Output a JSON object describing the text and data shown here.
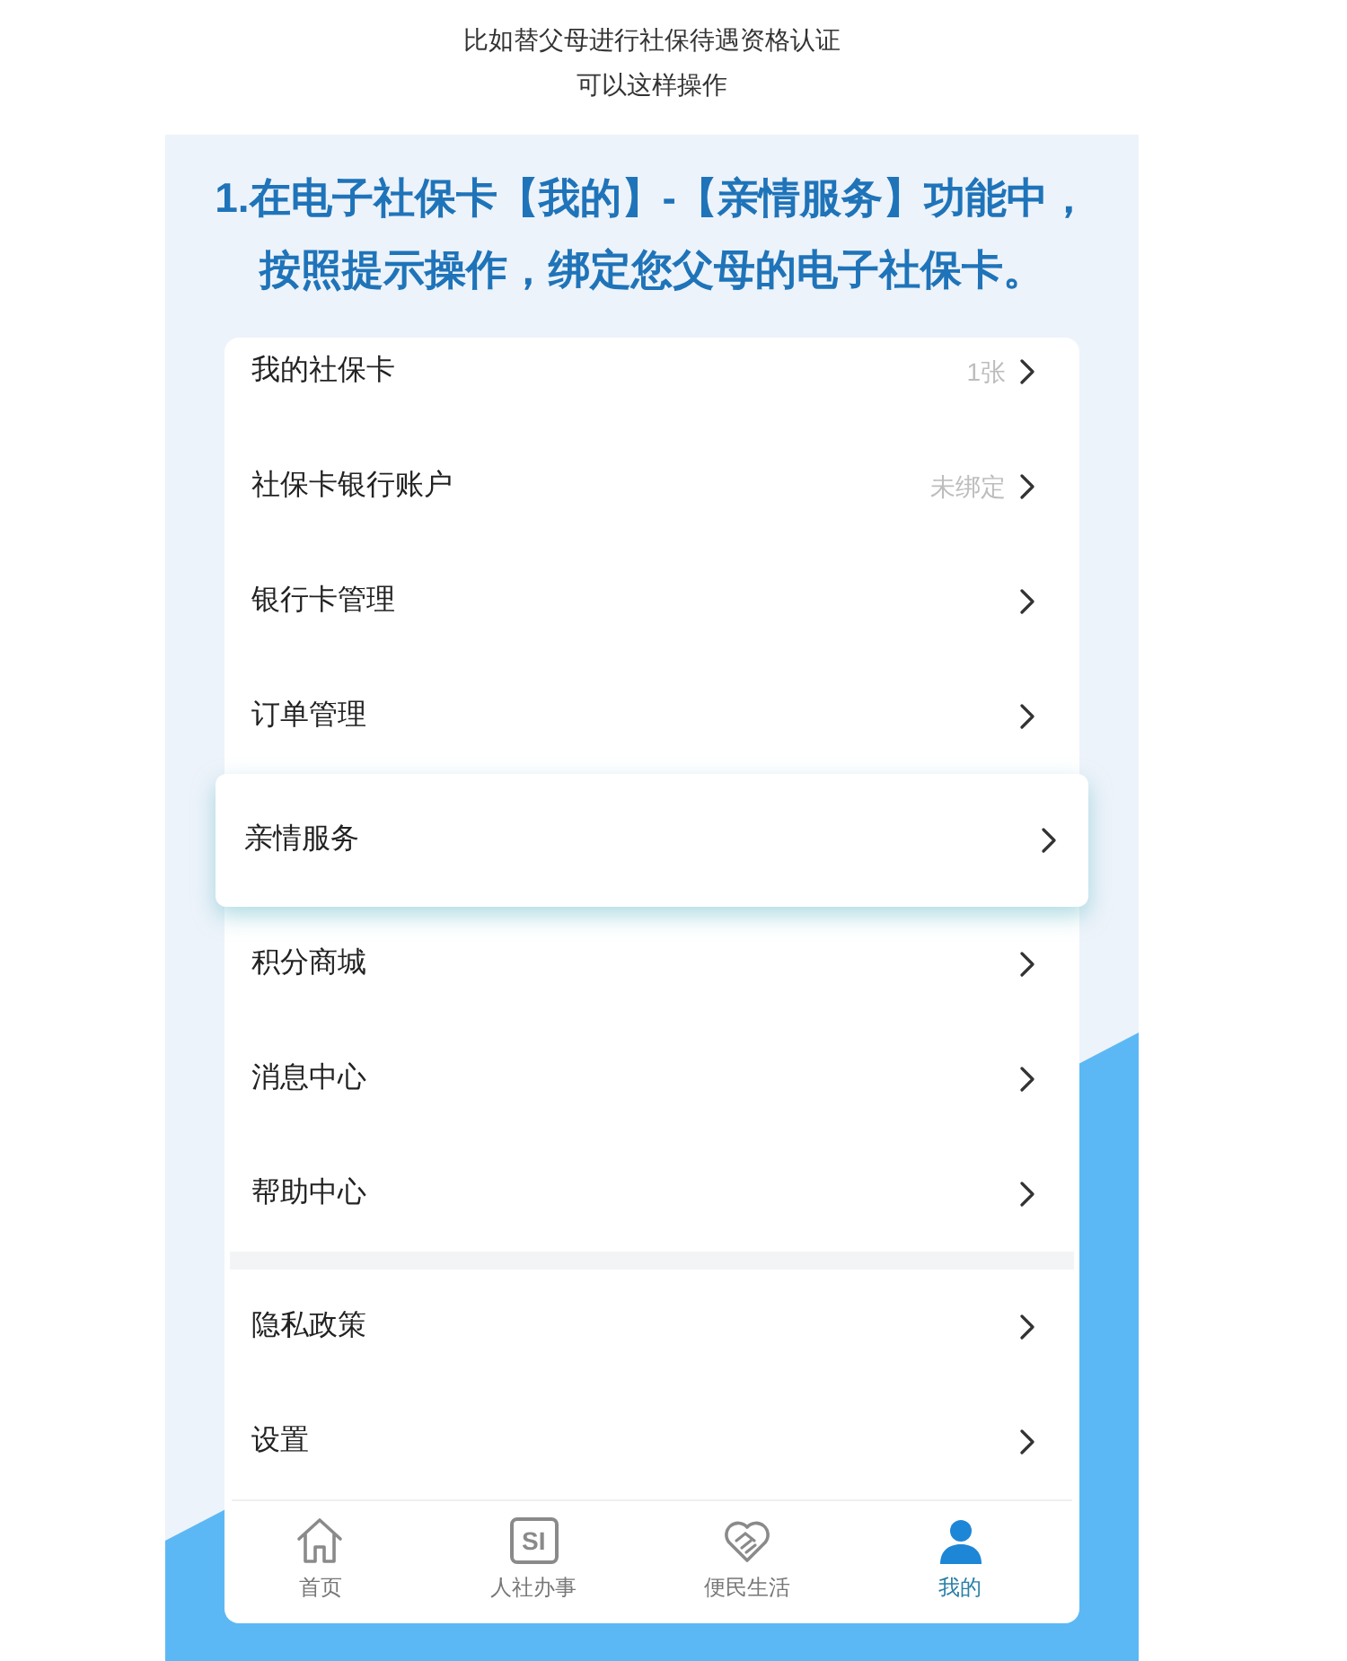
{
  "caption_lines": [
    "比如替父母进行社保待遇资格认证",
    "可以这样操作"
  ],
  "screenshot": {
    "heading": {
      "lines": [
        "1.在电子社保卡【我的】-【亲情服务】功能中，",
        "按照提示操作，绑定您父母的电子社保卡。"
      ]
    },
    "menu_sections": [
      {
        "items": [
          {
            "label": "我的社保卡",
            "value": "1张",
            "selected": false
          },
          {
            "label": "社保卡银行账户",
            "value": "未绑定",
            "selected": false
          },
          {
            "label": "银行卡管理",
            "selected": false
          },
          {
            "label": "订单管理",
            "selected": false
          },
          {
            "label": "亲情服务",
            "selected": true
          },
          {
            "label": "积分商城",
            "selected": false
          },
          {
            "label": "消息中心",
            "selected": false
          },
          {
            "label": "帮助中心",
            "selected": false
          }
        ]
      },
      {
        "items": [
          {
            "label": "隐私政策",
            "selected": false
          },
          {
            "label": "设置",
            "selected": false
          }
        ]
      }
    ],
    "tab_bar": {
      "tabs": [
        {
          "label": "首页",
          "selected": false
        },
        {
          "label": "人社办事",
          "icon_text": "SI",
          "selected": false
        },
        {
          "label": "便民生活",
          "selected": false
        },
        {
          "label": "我的",
          "selected": true
        }
      ]
    }
  }
}
